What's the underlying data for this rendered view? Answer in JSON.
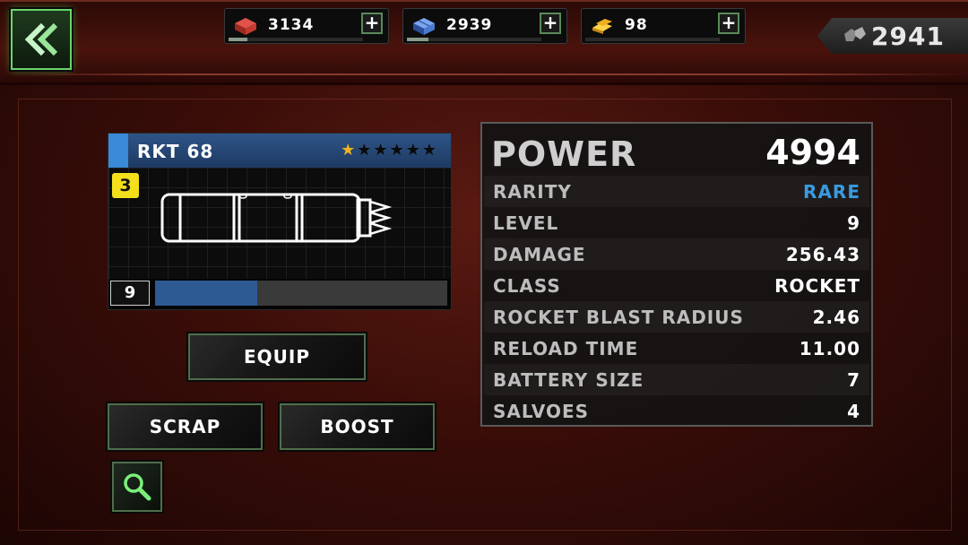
{
  "resources": [
    {
      "icon": "brick-icon",
      "value": "3134",
      "fill": 0.14,
      "color": "#c43a2e"
    },
    {
      "icon": "crystal-icon",
      "value": "2939",
      "fill": 0.16,
      "color": "#4a7ad0"
    },
    {
      "icon": "gold-bar-icon",
      "value": "98",
      "fill": 0.0,
      "color": "#f0b020"
    }
  ],
  "plus_label": "+",
  "gems": "2941",
  "weapon": {
    "name": "RKT 68",
    "stars_total": 6,
    "stars_filled": 1,
    "tier": "3",
    "level": "9",
    "xp_fill": 0.35
  },
  "buttons": {
    "equip": "EQUIP",
    "scrap": "SCRAP",
    "boost": "BOOST"
  },
  "stats": {
    "power_label": "POWER",
    "power_value": "4994",
    "rows": [
      {
        "key": "RARITY",
        "value": "RARE",
        "color": "#3a9ae0"
      },
      {
        "key": "LEVEL",
        "value": "9"
      },
      {
        "key": "DAMAGE",
        "value": "256.43"
      },
      {
        "key": "CLASS",
        "value": "ROCKET"
      },
      {
        "key": "ROCKET BLAST RADIUS",
        "value": "2.46"
      },
      {
        "key": "RELOAD TIME",
        "value": "11.00"
      },
      {
        "key": "BATTERY SIZE",
        "value": "7"
      },
      {
        "key": "SALVOES",
        "value": "4"
      }
    ]
  }
}
